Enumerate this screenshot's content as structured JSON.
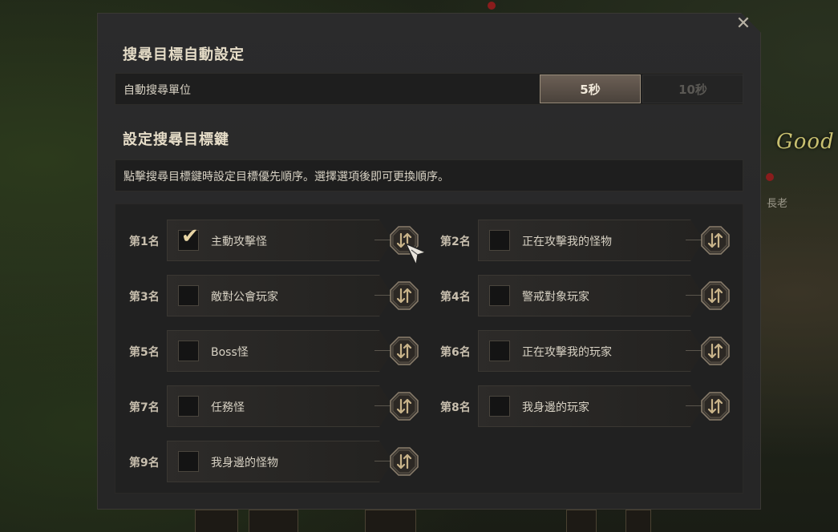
{
  "background": {
    "right_text": "Good",
    "right_subtext": "長老"
  },
  "dialog": {
    "close_label": "✕",
    "auto_section": {
      "title": "搜尋目標自動設定",
      "label": "自動搜尋單位",
      "options": [
        "5秒",
        "10秒"
      ],
      "selected": "5秒"
    },
    "key_section": {
      "title": "設定搜尋目標鍵",
      "description": "點擊搜尋目標鍵時設定目標優先順序。選擇選項後即可更換順序。"
    },
    "priorities": [
      {
        "rank": "第1名",
        "label": "主動攻擊怪",
        "checked": true
      },
      {
        "rank": "第2名",
        "label": "正在攻擊我的怪物",
        "checked": false
      },
      {
        "rank": "第3名",
        "label": "敵對公會玩家",
        "checked": false
      },
      {
        "rank": "第4名",
        "label": "警戒對象玩家",
        "checked": false
      },
      {
        "rank": "第5名",
        "label": "Boss怪",
        "checked": false
      },
      {
        "rank": "第6名",
        "label": "正在攻擊我的玩家",
        "checked": false
      },
      {
        "rank": "第7名",
        "label": "任務怪",
        "checked": false
      },
      {
        "rank": "第8名",
        "label": "我身邊的玩家",
        "checked": false
      },
      {
        "rank": "第9名",
        "label": "我身邊的怪物",
        "checked": false
      }
    ],
    "swap_icon": "swap-arrows-icon",
    "check_glyph": "✔"
  },
  "colors": {
    "accent": "#e6d3a3",
    "panel": "#2b2b2c",
    "active_segment": "#6b5f55"
  }
}
